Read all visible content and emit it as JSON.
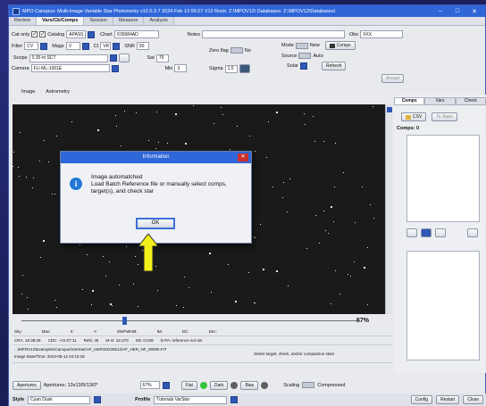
{
  "window": {
    "title": "MPO Canopus: Multi-Image Variable Star Photometry  v12.0.3.7  2024 Feb 13  09:27   V12 Rook: Z:\\MPOV12\\  Databases: Z:\\MPOV12\\Databases\\",
    "min": "–",
    "max": "□",
    "close": "✕"
  },
  "top_tabs": [
    "Review",
    "Vars/Ck/Comps",
    "Session",
    "Measure",
    "Analysis"
  ],
  "toolbar": {
    "cat_only_label": "Cat only",
    "catalog_label": "Catalog",
    "catalog_value": "APASS",
    "chart_label": "Chart",
    "chart_value": "X35684AD",
    "notes_label": "Notes",
    "obs_label": "Obs",
    "obs_value": "XXX",
    "filter_label": "Filter",
    "filter_value": "CV",
    "mags_label": "Mags",
    "mags_value": "V",
    "ci_label": "CI",
    "ci_value": "VR",
    "snr_label": "SNR",
    "snr_value": "50",
    "zero_flag_label": "Zero flag",
    "no_label": "No",
    "mode_label": "Mode",
    "new_label": "New",
    "comps_button": "Comps",
    "scope_label": "Scope",
    "scope_value": "0.35-m SCT",
    "sat_label": "Sat",
    "sat_value": "75",
    "sigma_label": "Sigma",
    "sigma_value": "1.5",
    "source_label": "Source",
    "auto_label": "Auto",
    "refresh_button": "Refresh",
    "accept_button": "Accept",
    "camera_label": "Camera",
    "camera_value": "FLI ML-1001E",
    "min_label": "Min",
    "min_value": "3",
    "solar_label": "Solar"
  },
  "sub_tabs": [
    "Image",
    "Astrometry"
  ],
  "right_panel": {
    "tabs": [
      "Comps",
      "Vars",
      "Check"
    ],
    "csv_button": "CSV",
    "to_stars_button": "To Stars",
    "comps_count": "Comps: 0"
  },
  "zoom_pct": "67%",
  "status": {
    "row1": [
      "Sky:",
      "Max:",
      "X:",
      "Y:",
      "SN/FWHM:",
      "IM:",
      "DC:",
      "Dec:"
    ],
    "row2": [
      "CRA: 16:38:28",
      "CDC: +41:07:11",
      "Refs: 46",
      "M-m: 22.270",
      "SD: 0.049",
      "D-PA: reference not set"
    ],
    "path": "...\\MPOV12\\Examples\\Canopus\\VarStar\\AF_HER\\20230512\\AF_HER_NF_00005.FIT",
    "date": "Image Date/Time: 2023-05-12  04:10:18",
    "hint": "Select target, check, and/or comparison stars"
  },
  "bottom": {
    "apertures_button": "Apertures",
    "apertures_label": "Apertures: 13x13/5/13/0*",
    "zoom_value": "67%",
    "flat_button": "Flat",
    "dark_button": "Dark",
    "bias_button": "Bias",
    "scaling_label": "Scaling",
    "compressed_label": "Compressed",
    "style_label": "Style",
    "style_value": "Cyan Dusk",
    "profile_label": "Profile",
    "profile_value": "Tutorials VarStar",
    "config_button": "Config",
    "restart_button": "Restart",
    "close_button": "Close"
  },
  "dialog": {
    "title": "Information",
    "message": "Image automatched\nLoad Batch Reference file or manually select comps, target(s), and check star",
    "ok": "OK",
    "close": "✕"
  },
  "colors": {
    "accent": "#2f66d8",
    "flat_dot": "#35c43a",
    "arrow": "#f3ef1a"
  }
}
